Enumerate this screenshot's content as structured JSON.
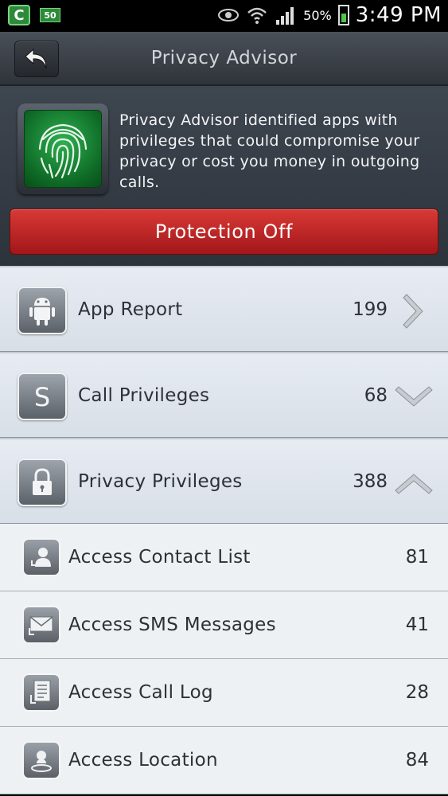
{
  "status_bar": {
    "notification_badge": "50",
    "battery_percent": "50%",
    "time": "3:49 PM",
    "icons": [
      "c-app-icon",
      "eye-icon",
      "wifi-icon",
      "signal-icon",
      "battery-icon"
    ]
  },
  "title_bar": {
    "title": "Privacy Advisor",
    "back_icon": "back-arrow-icon"
  },
  "header": {
    "icon": "fingerprint-icon",
    "description": "Privacy Advisor identified apps with privileges that could compromise your privacy or cost you money in outgoing calls.",
    "protection_button": "Protection Off",
    "protection_color": "#c02326"
  },
  "categories": [
    {
      "label": "App Report",
      "count": "199",
      "icon": "android-icon",
      "arrow": "chevron-right-icon"
    },
    {
      "label": "Call Privileges",
      "count": "68",
      "icon": "s-icon",
      "arrow": "chevron-down-icon"
    },
    {
      "label": "Privacy Privileges",
      "count": "388",
      "icon": "lock-icon",
      "arrow": "chevron-up-icon"
    }
  ],
  "privacy_items": [
    {
      "label": "Access Contact List",
      "count": "81",
      "icon": "contact-icon"
    },
    {
      "label": "Access SMS Messages",
      "count": "41",
      "icon": "envelope-icon"
    },
    {
      "label": "Access Call Log",
      "count": "28",
      "icon": "call-log-icon"
    },
    {
      "label": "Access Location",
      "count": "84",
      "icon": "location-icon"
    }
  ]
}
